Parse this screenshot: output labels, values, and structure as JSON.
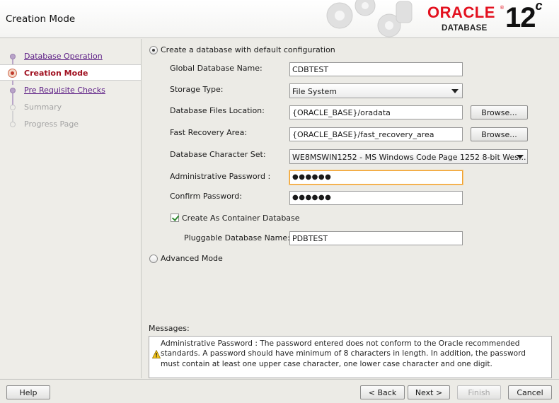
{
  "header": {
    "title": "Creation Mode",
    "brand": "ORACLE",
    "product": "DATABASE",
    "version": "12",
    "version_suffix": "c",
    "brand_color": "#e3101e"
  },
  "sidebar": {
    "steps": [
      {
        "label": "Database Operation",
        "state": "done"
      },
      {
        "label": "Creation Mode",
        "state": "current"
      },
      {
        "label": "Pre Requisite Checks",
        "state": "done"
      },
      {
        "label": "Summary",
        "state": "pending"
      },
      {
        "label": "Progress Page",
        "state": "pending"
      }
    ]
  },
  "form": {
    "default_mode_label": "Create a database with default configuration",
    "default_mode_selected": true,
    "global_db_name": {
      "label": "Global Database Name:",
      "value": "CDBTEST"
    },
    "storage_type": {
      "label": "Storage Type:",
      "value": "File System"
    },
    "db_files_location": {
      "label": "Database Files Location:",
      "value": "{ORACLE_BASE}/oradata",
      "browse": "Browse..."
    },
    "fast_recovery_area": {
      "label": "Fast Recovery Area:",
      "value": "{ORACLE_BASE}/fast_recovery_area",
      "browse": "Browse..."
    },
    "charset": {
      "label": "Database Character Set:",
      "value": "WE8MSWIN1252 - MS Windows Code Page 1252 8-bit Wes..."
    },
    "admin_password": {
      "label": "Administrative Password :",
      "value": "●●●●●●"
    },
    "confirm_password": {
      "label": "Confirm Password:",
      "value": "●●●●●●"
    },
    "container_db": {
      "label": "Create As Container Database",
      "checked": true
    },
    "pluggable_db_name": {
      "label": "Pluggable Database Name:",
      "value": "PDBTEST"
    },
    "advanced_mode_label": "Advanced Mode",
    "advanced_mode_selected": false
  },
  "messages": {
    "label": "Messages:",
    "text": "Administrative Password : The password entered does not conform to the Oracle recommended standards. A password should have minimum of 8 characters in length. In addition, the password must contain at least one upper case character, one lower case character and one digit."
  },
  "footer": {
    "help": "Help",
    "back": "< Back",
    "next": "Next >",
    "finish": "Finish",
    "cancel": "Cancel"
  }
}
